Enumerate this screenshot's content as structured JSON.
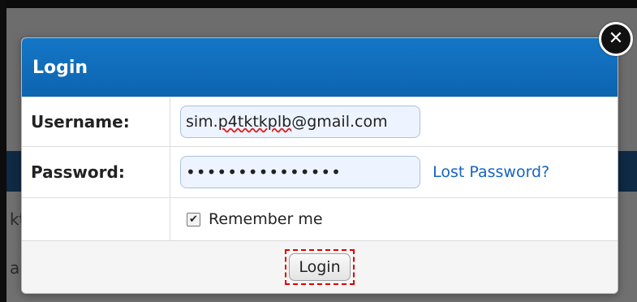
{
  "background": {
    "fragment_row1": "kt",
    "fragment_row2": "au"
  },
  "modal": {
    "title": "Login",
    "close_icon": "close-icon",
    "username_label": "Username:",
    "username_value_prefix": "sim.",
    "username_value_misspelled": "p4tktkplb",
    "username_value_suffix": "@gmail.com",
    "password_label": "Password:",
    "password_value": "•••••••••••••••",
    "lost_password_link": "Lost Password?",
    "remember_label": "Remember me",
    "remember_checked": true,
    "login_button": "Login",
    "colors": {
      "header": "#0d64b0",
      "link": "#1565c0",
      "highlight": "#e00000"
    }
  }
}
